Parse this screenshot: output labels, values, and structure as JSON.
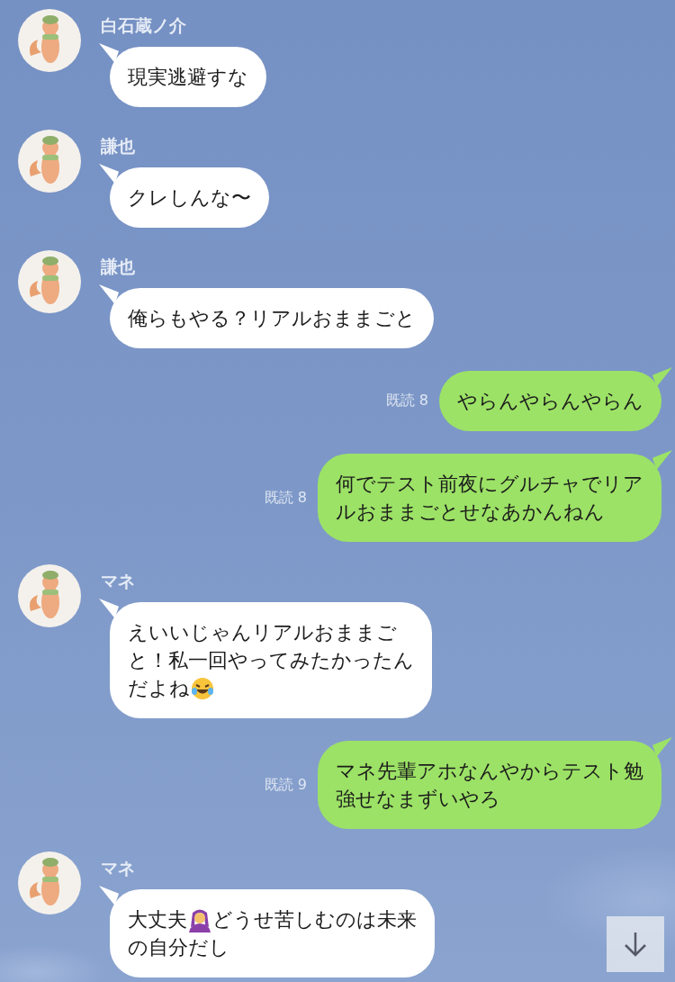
{
  "messages": [
    {
      "kind": "incoming",
      "sender": "白石蔵ノ介",
      "lines": [
        [
          {
            "kind": "text",
            "text": "現実逃避すな"
          }
        ]
      ]
    },
    {
      "kind": "incoming",
      "sender": "謙也",
      "lines": [
        [
          {
            "kind": "text",
            "text": "クレしんな〜"
          }
        ]
      ]
    },
    {
      "kind": "incoming",
      "sender": "謙也",
      "lines": [
        [
          {
            "kind": "text",
            "text": "俺らもやる？リアルおままごと"
          }
        ]
      ]
    },
    {
      "kind": "outgoing",
      "read": "既読 8",
      "lines": [
        [
          {
            "kind": "text",
            "text": "やらんやらんやらん"
          }
        ]
      ]
    },
    {
      "kind": "outgoing",
      "read": "既読 8",
      "lines": [
        [
          {
            "kind": "text",
            "text": "何でテスト前夜にグルチャでリア"
          }
        ],
        [
          {
            "kind": "text",
            "text": "ルおままごとせなあかんねん"
          }
        ]
      ]
    },
    {
      "kind": "incoming",
      "sender": "マネ",
      "lines": [
        [
          {
            "kind": "text",
            "text": "えいいじゃんリアルおままご"
          }
        ],
        [
          {
            "kind": "text",
            "text": "と！私一回やってみたかったん"
          }
        ],
        [
          {
            "kind": "text",
            "text": "だよね"
          },
          {
            "kind": "laugh"
          }
        ]
      ]
    },
    {
      "kind": "outgoing",
      "read": "既読 9",
      "lines": [
        [
          {
            "kind": "text",
            "text": "マネ先輩アホなんやからテスト勉"
          }
        ],
        [
          {
            "kind": "text",
            "text": "強せなまずいやろ"
          }
        ]
      ]
    },
    {
      "kind": "incoming",
      "sender": "マネ",
      "lines": [
        [
          {
            "kind": "text",
            "text": "大丈夫"
          },
          {
            "kind": "arms-up"
          },
          {
            "kind": "text",
            "text": "どうせ苦しむのは未来"
          }
        ],
        [
          {
            "kind": "text",
            "text": "の自分だし"
          }
        ]
      ]
    }
  ],
  "scroll_button": {
    "kind": "down"
  }
}
